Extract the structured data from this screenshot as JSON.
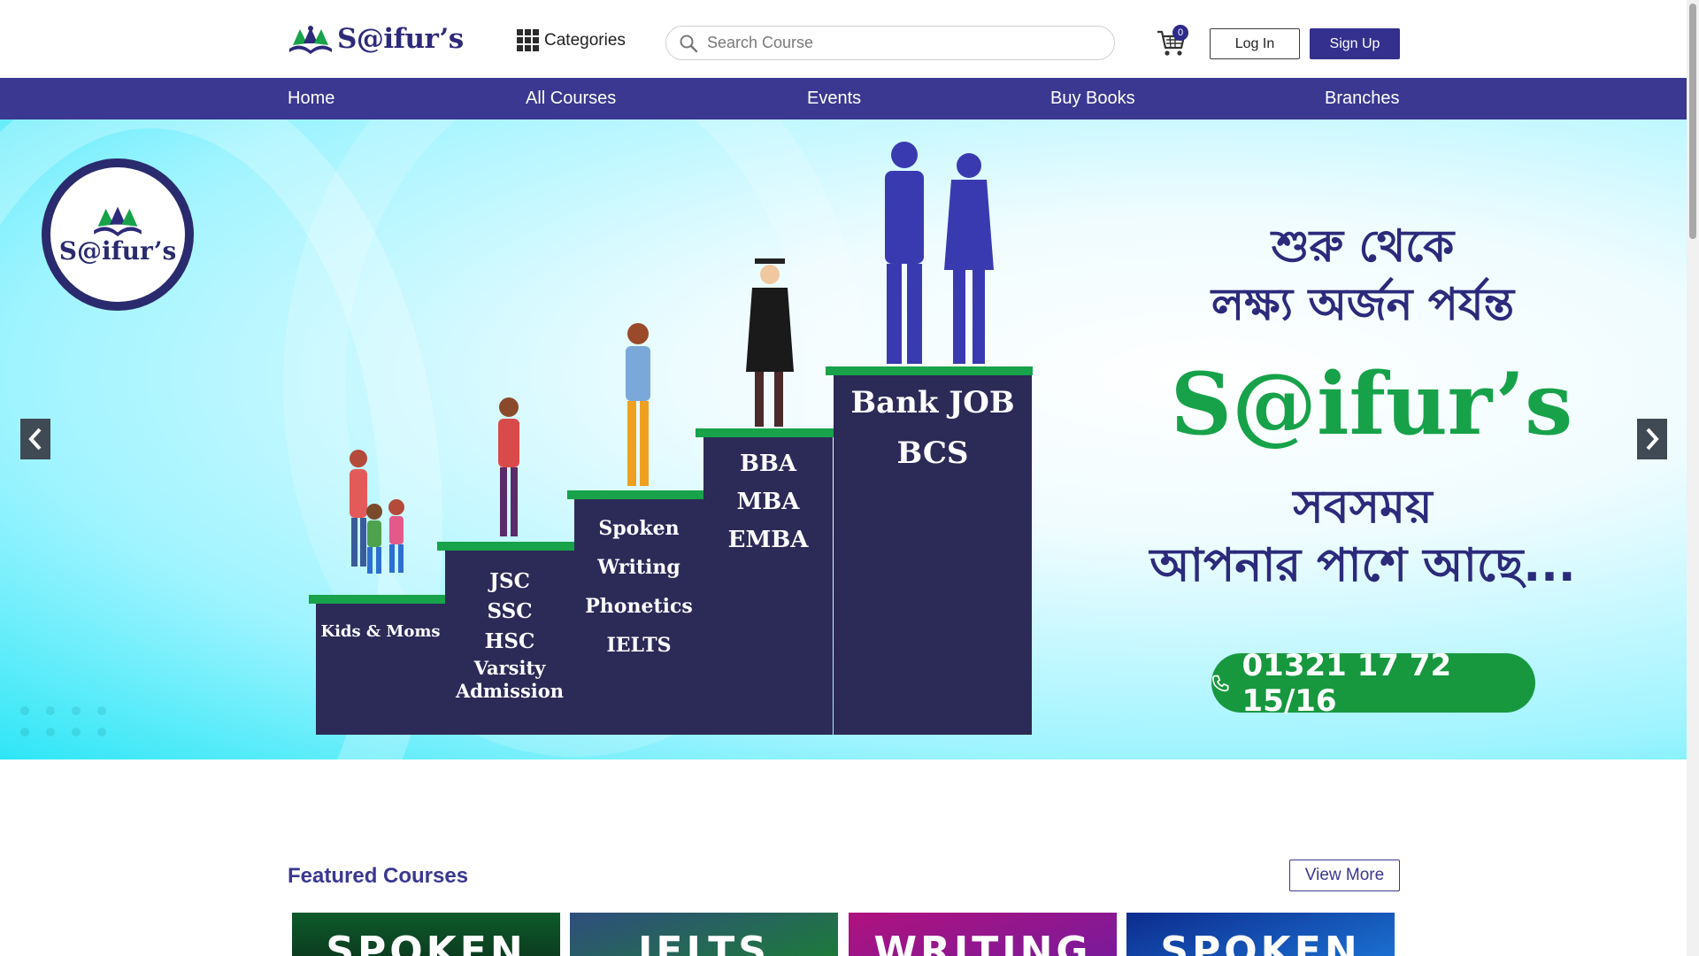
{
  "header": {
    "logo_text": "S@ifur’s",
    "categories_label": "Categories",
    "search_placeholder": "Search Course",
    "cart_count": "0",
    "login_label": "Log In",
    "signup_label": "Sign Up"
  },
  "nav": {
    "items": [
      {
        "label": "Home"
      },
      {
        "label": "All Courses"
      },
      {
        "label": "Events"
      },
      {
        "label": "Buy Books"
      },
      {
        "label": "Branches"
      }
    ]
  },
  "hero": {
    "badge_text": "S@ifur’s",
    "stairs": [
      {
        "lines": [
          "Kids & Moms"
        ]
      },
      {
        "lines": [
          "JSC",
          "SSC",
          "HSC",
          "Varsity",
          "Admission"
        ]
      },
      {
        "lines": [
          "Spoken",
          "Writing",
          "Phonetics",
          "IELTS"
        ]
      },
      {
        "lines": [
          "BBA",
          "MBA",
          "EMBA"
        ]
      },
      {
        "lines": [
          "Bank JOB",
          "BCS"
        ]
      }
    ],
    "bangla_line1": "শুরু থেকে",
    "bangla_line2": "লক্ষ্য অর্জন পর্যন্ত",
    "brand": "S@ifur’s",
    "bangla_line3": "সবসময়",
    "bangla_line4": "আপনার পাশে আছে...",
    "phone": "01321 17 72 15/16"
  },
  "featured": {
    "title": "Featured Courses",
    "view_more": "View More",
    "cards": [
      {
        "label": "SPOKEN",
        "color_top": "#0e5a2c",
        "color_bottom": "#0b3d1f"
      },
      {
        "label": "IELTS",
        "color_top": "#2f4e7d",
        "color_bottom": "#1d7a3b"
      },
      {
        "label": "WRITING",
        "color_top": "#b0127e",
        "color_bottom": "#7a1a9a"
      },
      {
        "label": "SPOKEN",
        "color_top": "#0d2c8e",
        "color_bottom": "#1a6fd0"
      }
    ]
  },
  "colors": {
    "brand_purple": "#3a3891",
    "brand_green": "#17a24a",
    "hero_cyan": "#2ee6f6"
  }
}
